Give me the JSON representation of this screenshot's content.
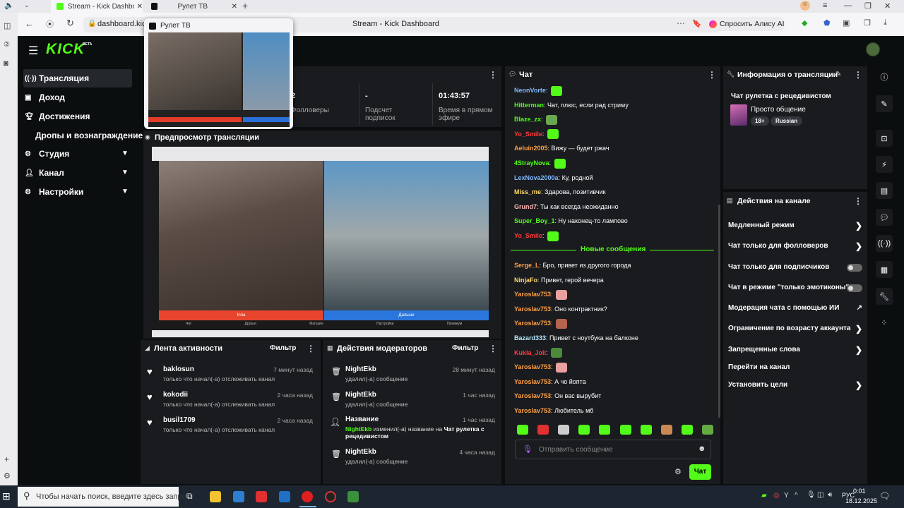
{
  "browser": {
    "tabs": [
      {
        "title": "Stream - Kick Dashboard",
        "active": true
      },
      {
        "title": "Рулет ТВ",
        "active": false
      }
    ],
    "url": "dashboard.kick",
    "page_title": "Stream - Kick Dashboard",
    "alice_label": "Спросить Алису AI",
    "popup_title": "Рулет ТВ"
  },
  "logo": "KICK",
  "logo_badge": "BETA",
  "sidebar": {
    "items": [
      {
        "label": "Трансляция",
        "active": true
      },
      {
        "label": "Доход"
      },
      {
        "label": "Достижения"
      },
      {
        "label": "Дропы и вознаграждение"
      },
      {
        "label": "Студия"
      },
      {
        "label": "Канал"
      },
      {
        "label": "Настройки"
      }
    ]
  },
  "stats": [
    {
      "value": "2",
      "label": "Фолловеры"
    },
    {
      "value": "-",
      "label": "Подсчет подписок"
    },
    {
      "value": "01:43:57",
      "label": "Время в прямом эфире"
    }
  ],
  "preview": {
    "title": "Предпросмотр трансляции",
    "overlay_left": "Inna",
    "overlay_right": "Дальше",
    "bottom_items": [
      "Чат",
      "Друзья",
      "Магазин",
      "Настройки",
      "Премиум"
    ]
  },
  "activity": {
    "title": "Лента активности",
    "filter": "Фильтр",
    "items": [
      {
        "name": "baklosun",
        "time": "7 минут назад",
        "text": "только что начал(-а) отслеживать канал"
      },
      {
        "name": "kokodii",
        "time": "2 часа назад",
        "text": "только что начал(-а) отслеживать канал"
      },
      {
        "name": "busil1709",
        "time": "2 часа назад",
        "text": "только что начал(-а) отслеживать канал"
      }
    ]
  },
  "modactions": {
    "title": "Действия модераторов",
    "filter": "Фильтр",
    "items": [
      {
        "name": "NightEkb",
        "time": "28 минут назад",
        "text": "удалил(-а) сообщение"
      },
      {
        "name": "NightEkb",
        "time": "1 час назад",
        "text": "удалил(-а) сообщение"
      },
      {
        "name": "Название",
        "time": "1 час назад",
        "actor": "NightEkb",
        "text": " изменил(-а) название на ",
        "newtitle": "Чат рулетка с рецедивистом"
      },
      {
        "name": "NightEkb",
        "time": "4 часа назад",
        "text": "удалил(-а) сообщение"
      }
    ]
  },
  "chat": {
    "title": "Чат",
    "new_messages": "Новые сообщения",
    "input_placeholder": "Отправить сообщение",
    "send": "Чат",
    "messages": [
      {
        "user": "NeonVorte",
        "color": "#7fb8ff",
        "text": "",
        "emote": "#53fc18"
      },
      {
        "user": "Hitterman",
        "color": "#53fc18",
        "text": "Чат, плюс, если рад стриму"
      },
      {
        "user": "Blaze_zx",
        "color": "#53fc18",
        "text": "",
        "emote": "#6aa84f"
      },
      {
        "user": "Yo_Smile",
        "color": "#ff3b3b",
        "text": "",
        "emote": "#53fc18"
      },
      {
        "user": "Aeluin2005",
        "color": "#ff9f40",
        "text": "Вижу — будет ржач"
      },
      {
        "user": "4StrayNova",
        "color": "#53fc18",
        "text": "",
        "emote": "#53fc18"
      },
      {
        "user": "LexNova2000a",
        "color": "#7fb8ff",
        "text": "Ку, родной"
      },
      {
        "user": "Miss_me",
        "color": "#ffd966",
        "text": "Здарова, позитивчик"
      },
      {
        "user": "Grund7",
        "color": "#ffb3b3",
        "text": "Ты как всегда неожиданно"
      },
      {
        "user": "Super_Boy_1",
        "color": "#53fc18",
        "text": "Ну наконец-то лампово"
      },
      {
        "user": "Yo_Smile",
        "color": "#ff3b3b",
        "text": "",
        "emote": "#53fc18"
      }
    ],
    "new": [
      {
        "user": "Serge_L",
        "color": "#ff9f40",
        "text": "Бро, привет из другого города"
      },
      {
        "user": "NinjaFo",
        "color": "#ffd966",
        "text": "Привет, герой вечера"
      },
      {
        "user": "Yaroslav753",
        "color": "#ff9f40",
        "text": "",
        "emote": "#e8a0a0"
      },
      {
        "user": "Yaroslav753",
        "color": "#ff9f40",
        "text": "Оно контрактник?"
      },
      {
        "user": "Yaroslav753",
        "color": "#ff9f40",
        "text": "",
        "emote": "#b5654d"
      },
      {
        "user": "Bazard333",
        "color": "#b3e6ff",
        "text": "Привет с ноутбука на балконе"
      },
      {
        "user": "Kukla_Joli",
        "color": "#ff3b3b",
        "text": "",
        "emote": "#4a8a3a"
      },
      {
        "user": "Yaroslav753",
        "color": "#ff9f40",
        "text": "",
        "emote": "#e8a0a0"
      },
      {
        "user": "Yaroslav753",
        "color": "#ff9f40",
        "text": "А чо йопта"
      },
      {
        "user": "Yaroslav753",
        "color": "#ff9f40",
        "text": "Он вас вырубит"
      },
      {
        "user": "Yaroslav753",
        "color": "#ff9f40",
        "text": "Любитель мб"
      }
    ]
  },
  "stream_info": {
    "title": "Информация о трансляции",
    "stream_title": "Чат рулетка с рецедивистом",
    "category": "Просто общение",
    "tags": [
      "18+",
      "Russian"
    ]
  },
  "channel_actions": {
    "title": "Действия на канале",
    "items": [
      {
        "label": "Медленный режим",
        "kind": "chevron"
      },
      {
        "label": "Чат только для фолловеров",
        "kind": "chevron"
      },
      {
        "label": "Чат только для подписчиков",
        "kind": "toggle"
      },
      {
        "label": "Чат в режиме \"только эмотиконы\"",
        "kind": "toggle"
      },
      {
        "label": "Модерация чата с помощью ИИ",
        "kind": "external"
      },
      {
        "label": "Ограничение по возрасту аккаунта",
        "kind": "chevron"
      },
      {
        "label": "Запрещенные слова",
        "kind": "chevron"
      },
      {
        "label": "Перейти на канал",
        "kind": "none"
      },
      {
        "label": "Установить цели",
        "kind": "chevron"
      }
    ]
  },
  "taskbar": {
    "search_placeholder": "Чтобы начать поиск, введите здесь запрос",
    "lang": "РУС",
    "time": "0:01",
    "date": "18.12.2025"
  },
  "colors": {
    "accent": "#53fc18",
    "panel": "#191b1f",
    "bg": "#0b0e0f"
  }
}
